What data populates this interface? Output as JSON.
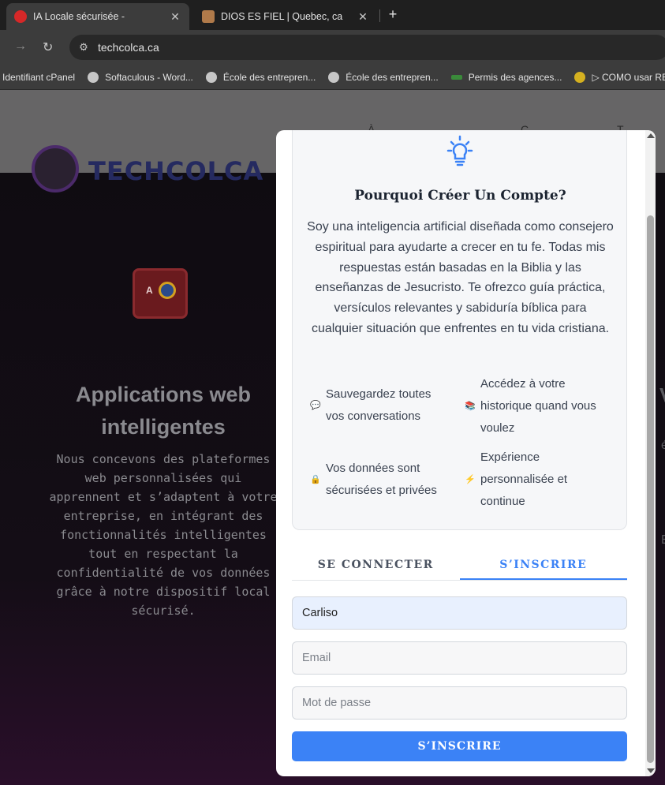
{
  "browser": {
    "tabs": [
      {
        "title": "IA Locale sécurisée -",
        "active": true
      },
      {
        "title": "DIOS ES FIEL | Quebec, ca",
        "active": false
      }
    ],
    "new_tab_label": "+",
    "url": "techcolca.ca",
    "bookmarks": [
      "Identifiant cPanel",
      "Softaculous - Word...",
      "École des entrepren...",
      "École des entrepren...",
      "Permis des agences...",
      "▷ COMO usar RES"
    ]
  },
  "site": {
    "logo_text": "TECHCOLCA",
    "feature_title": "Applications web intelligentes",
    "feature_description": "Nous concevons des plateformes web personnalisées qui apprennent et s’adaptent à votre entreprise, en intégrant des fonctionnalités intelligentes tout en respectant la confidentialité de vos données grâce à notre dispositif local sécurisé.",
    "feature_icon_text": "A"
  },
  "modal": {
    "card_title": "Pourquoi Créer Un Compte?",
    "card_description": "Soy una inteligencia artificial diseñada como consejero espiritual para ayudarte a crecer en tu fe. Todas mis respuestas están basadas en la Biblia y las enseñanzas de Jesucristo. Te ofrezco guía práctica, versículos relevantes y sabiduría bíblica para cualquier situación que enfrentes en tu vida cristiana.",
    "benefits": [
      {
        "icon": "speech-bubble-icon",
        "glyph": "💬",
        "text": "Sauvegardez toutes vos conversations"
      },
      {
        "icon": "books-icon",
        "glyph": "📚",
        "text": "Accédez à votre historique quand vous voulez"
      },
      {
        "icon": "lock-icon",
        "glyph": "🔒",
        "text": "Vos données sont sécurisées et privées"
      },
      {
        "icon": "lightning-icon",
        "glyph": "⚡",
        "text": "Expérience personnalisée et continue"
      }
    ],
    "tabs": {
      "login": "SE CONNECTER",
      "signup": "S’INSCRIRE"
    },
    "active_tab": "signup",
    "fields": {
      "name_value": "Carliso",
      "email_placeholder": "Email",
      "password_placeholder": "Mot de passe"
    },
    "submit_label": "S’INSCRIRE",
    "accent_color": "#3b82f6"
  }
}
